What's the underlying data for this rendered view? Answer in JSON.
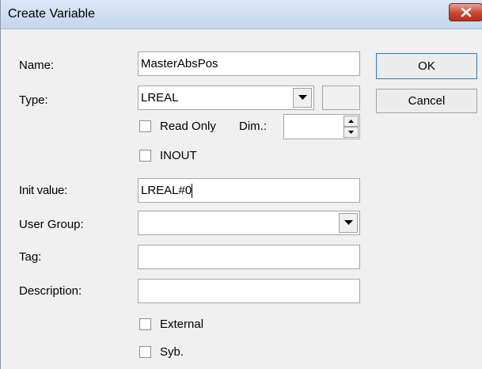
{
  "window": {
    "title": "Create Variable"
  },
  "fields": {
    "name": {
      "label": "Name:",
      "value": "MasterAbsPos"
    },
    "type": {
      "label": "Type:",
      "value": "LREAL"
    },
    "read_only": {
      "label": "Read Only",
      "checked": false
    },
    "dim": {
      "label": "Dim.:",
      "value": ""
    },
    "inout": {
      "label": "INOUT",
      "checked": false
    },
    "init_value": {
      "label": "Init value:",
      "value": "LREAL#0"
    },
    "user_group": {
      "label": "User Group:",
      "value": ""
    },
    "tag": {
      "label": "Tag:",
      "value": ""
    },
    "description": {
      "label": "Description:",
      "value": ""
    },
    "external": {
      "label": "External",
      "checked": false
    },
    "syb": {
      "label": "Syb.",
      "checked": false
    }
  },
  "buttons": {
    "ok": "OK",
    "cancel": "Cancel"
  },
  "icons": {
    "close": "close-icon",
    "dropdown": "chevron-down-icon",
    "spin_up": "arrow-up-icon",
    "spin_down": "arrow-down-icon"
  },
  "colors": {
    "titlebar": "#c4d6ec",
    "close_button": "#c9452f",
    "dialog_background": "#f0f0f0"
  }
}
